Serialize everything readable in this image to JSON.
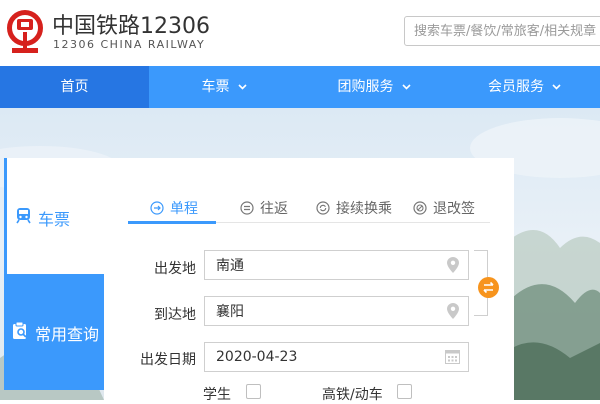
{
  "brand": {
    "name_cn": "中国铁路12306",
    "name_en": "12306 CHINA RAILWAY",
    "color": "#d6211d"
  },
  "search": {
    "placeholder": "搜索车票/餐饮/常旅客/相关规章"
  },
  "nav": {
    "items": [
      {
        "label": "首页",
        "active": true
      },
      {
        "label": "车票",
        "dropdown": true
      },
      {
        "label": "团购服务",
        "dropdown": true
      },
      {
        "label": "会员服务",
        "dropdown": true
      }
    ],
    "color": "#3b99fc",
    "active_color": "#2676e3"
  },
  "side_tabs": {
    "ticket": {
      "label": "车票",
      "icon": "train-icon"
    },
    "query": {
      "label": "常用查询",
      "icon": "clipboard-search-icon"
    }
  },
  "trip_tabs": [
    {
      "label": "单程",
      "icon": "arrow-circle-icon",
      "active": true
    },
    {
      "label": "往返",
      "icon": "equals-circle-icon"
    },
    {
      "label": "接续换乘",
      "icon": "refresh-circle-icon"
    },
    {
      "label": "退改签",
      "icon": "cancel-circle-icon"
    }
  ],
  "form": {
    "from": {
      "label": "出发地",
      "value": "南通",
      "icon": "location-pin-icon"
    },
    "to": {
      "label": "到达地",
      "value": "襄阳",
      "icon": "location-pin-icon"
    },
    "date": {
      "label": "出发日期",
      "value": "2020-04-23",
      "icon": "calendar-icon"
    },
    "swap_icon": "swap-icon",
    "swap_color": "#f7941d",
    "options": [
      {
        "label": "学生",
        "checked": false
      },
      {
        "label": "高铁/动车",
        "checked": false
      }
    ]
  }
}
